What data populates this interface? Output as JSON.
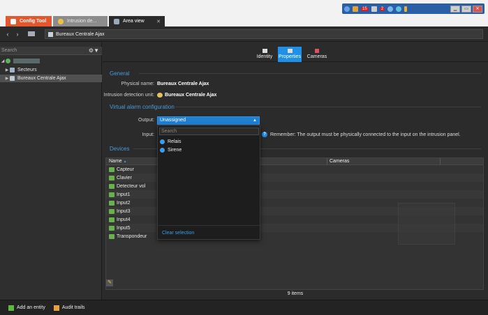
{
  "tabs": [
    {
      "label": "Config Tool"
    },
    {
      "label": "Intrusion de..."
    },
    {
      "label": "Area view"
    }
  ],
  "tray": {
    "badge_alarms": "15",
    "badge_other": "2"
  },
  "breadcrumb": {
    "label": "Bureaux Centrale Ajax"
  },
  "left": {
    "search_placeholder": "Search",
    "tree": [
      {
        "label": ""
      },
      {
        "label": "Secteurs"
      },
      {
        "label": "Bureaux Centrale Ajax"
      }
    ]
  },
  "page_tabs": [
    {
      "label": "Identity"
    },
    {
      "label": "Properties"
    },
    {
      "label": "Cameras"
    }
  ],
  "general": {
    "title": "General",
    "physical_name_label": "Physical name:",
    "physical_name_value": "Bureaux Centrale Ajax",
    "idu_label": "Intrusion detection unit:",
    "idu_value": "Bureaux Centrale Ajax"
  },
  "virtual_alarm": {
    "title": "Virtual alarm configuration",
    "output_label": "Output:",
    "output_value": "Unassigned",
    "input_label": "Input:",
    "remember": "Remember: The output must be physically connected to the input on the intrusion panel."
  },
  "devices": {
    "title": "Devices",
    "col_name": "Name",
    "col_cameras": "Cameras",
    "rows": [
      "Capteur",
      "Clavier",
      "Detecteur vol",
      "Input1",
      "Input2",
      "Input3",
      "Input4",
      "Input5",
      "Transpondeur"
    ],
    "count": "9 items"
  },
  "dropdown": {
    "search_placeholder": "Search",
    "items": [
      "Relais",
      "Sirene"
    ],
    "clear": "Clear selection"
  },
  "bottom": {
    "add_entity": "Add an entity",
    "audit_trails": "Audit trails"
  }
}
